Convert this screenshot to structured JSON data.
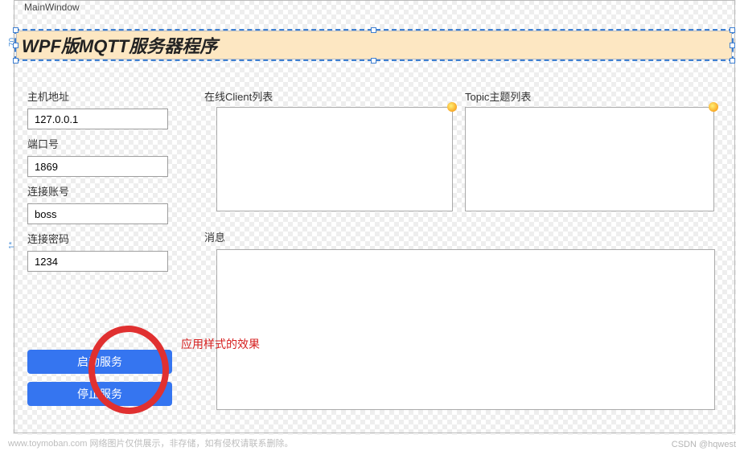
{
  "window": {
    "designerTitle": "MainWindow",
    "appTitle": "WPF版MQTT服务器程序"
  },
  "ruler": {
    "mark1": "70",
    "mark2": "1*"
  },
  "fields": {
    "host": {
      "label": "主机地址",
      "value": "127.0.0.1"
    },
    "port": {
      "label": "端口号",
      "value": "1869"
    },
    "account": {
      "label": "连接账号",
      "value": "boss"
    },
    "password": {
      "label": "连接密码",
      "value": "1234"
    }
  },
  "buttons": {
    "start": "启动服务",
    "stop": "停止服务"
  },
  "panels": {
    "clientsLabel": "在线Client列表",
    "topicsLabel": "Topic主题列表",
    "messagesLabel": "消息"
  },
  "annotation": {
    "text": "应用样式的效果"
  },
  "footer": {
    "watermark": "www.toymoban.com  网络图片仅供展示，非存储，如有侵权请联系删除。",
    "credit": "CSDN @hqwest"
  }
}
